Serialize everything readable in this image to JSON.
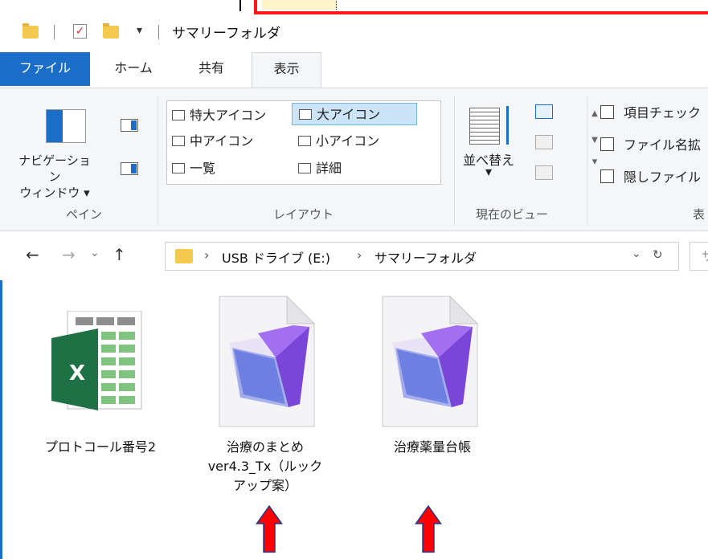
{
  "window": {
    "title": "サマリーフォルダ",
    "qa_dropdown": "▾"
  },
  "tabs": [
    {
      "label": "ファイル"
    },
    {
      "label": "ホーム"
    },
    {
      "label": "共有"
    },
    {
      "label": "表示"
    }
  ],
  "ribbon": {
    "pane": {
      "nav_label_1": "ナビゲーション",
      "nav_label_2": "ウィンドウ ▾",
      "group": "ペイン"
    },
    "layout": {
      "items": [
        "特大アイコン",
        "大アイコン",
        "中アイコン",
        "小アイコン",
        "一覧",
        "詳細"
      ],
      "group": "レイアウト",
      "scroll_up": "▲",
      "scroll_down": "▼",
      "scroll_more": "▾"
    },
    "current_view": {
      "sort_label_1": "並べ替え",
      "sort_label_2": "▾",
      "group": "現在のビュー"
    },
    "show_hide": {
      "items": [
        "項目チェック",
        "ファイル名拡",
        "隠しファイル"
      ],
      "group": "表"
    }
  },
  "address": {
    "back": "←",
    "forward": "→",
    "recent": "⌄",
    "up": "↑",
    "crumbs": [
      "USB ドライブ (E:)",
      "サマリーフォルダ"
    ],
    "separator": "›",
    "dropdown": "⌄",
    "refresh": "↻",
    "search_hint": "サ"
  },
  "files": [
    {
      "name": "プロトコール番号2",
      "icon": "excel-icon"
    },
    {
      "name_1": "治療のまとめ",
      "name_2": "ver4.3_Tx（ルック",
      "name_3": "アップ案）",
      "icon": "filemaker-icon"
    },
    {
      "name": "治療薬量台帳",
      "icon": "filemaker-icon"
    }
  ],
  "colors": {
    "accent": "#1a6ec8",
    "annotation": "#ff0000",
    "excel": "#1e7145"
  }
}
